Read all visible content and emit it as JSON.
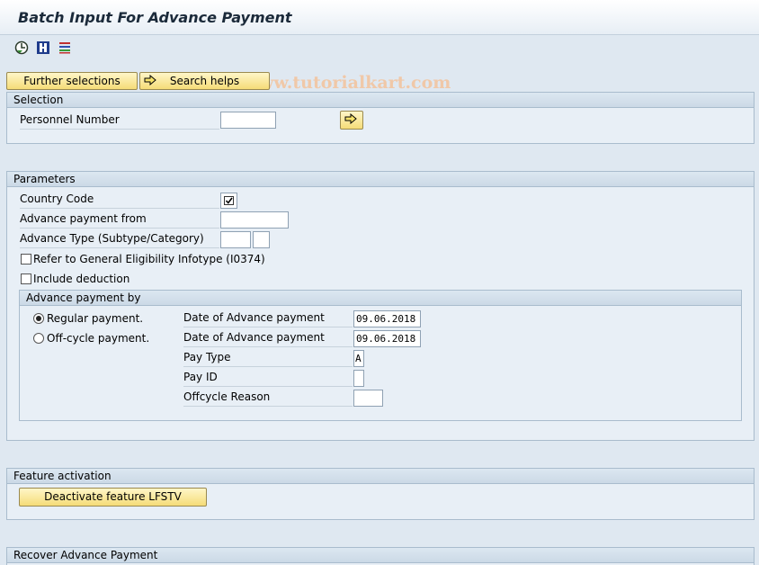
{
  "window": {
    "title": "Batch Input For Advance Payment"
  },
  "toolbar": {
    "icons": [
      "execute-icon",
      "info-icon",
      "selection-options-icon"
    ],
    "watermark": "© www.tutorialkart.com"
  },
  "buttons": {
    "further_selections": "Further selections",
    "search_helps": "Search helps"
  },
  "selection": {
    "header": "Selection",
    "personnel_number_label": "Personnel Number",
    "personnel_number_value": ""
  },
  "parameters": {
    "header": "Parameters",
    "country_code_label": "Country Code",
    "country_code_checked": true,
    "advance_payment_from_label": "Advance payment from",
    "advance_payment_from_value": "",
    "advance_type_label": "Advance Type (Subtype/Category)",
    "refer_label": "Refer to General Eligibility Infotype (I0374)",
    "include_deduction_label": "Include deduction",
    "advance_by": {
      "header": "Advance payment by",
      "regular_label": "Regular payment.",
      "offcycle_label": "Off-cycle payment.",
      "date_label_1": "Date of Advance payment",
      "date_value_1": "09.06.2018",
      "date_label_2": "Date of Advance payment",
      "date_value_2": "09.06.2018",
      "pay_type_label": "Pay Type",
      "pay_type_value": "A",
      "pay_id_label": "Pay ID",
      "pay_id_value": "",
      "offcycle_reason_label": "Offcycle Reason",
      "offcycle_reason_value": ""
    }
  },
  "feature": {
    "header": "Feature activation",
    "deactivate_label": "Deactivate feature LFSTV"
  },
  "recover": {
    "header": "Recover Advance Payment"
  }
}
